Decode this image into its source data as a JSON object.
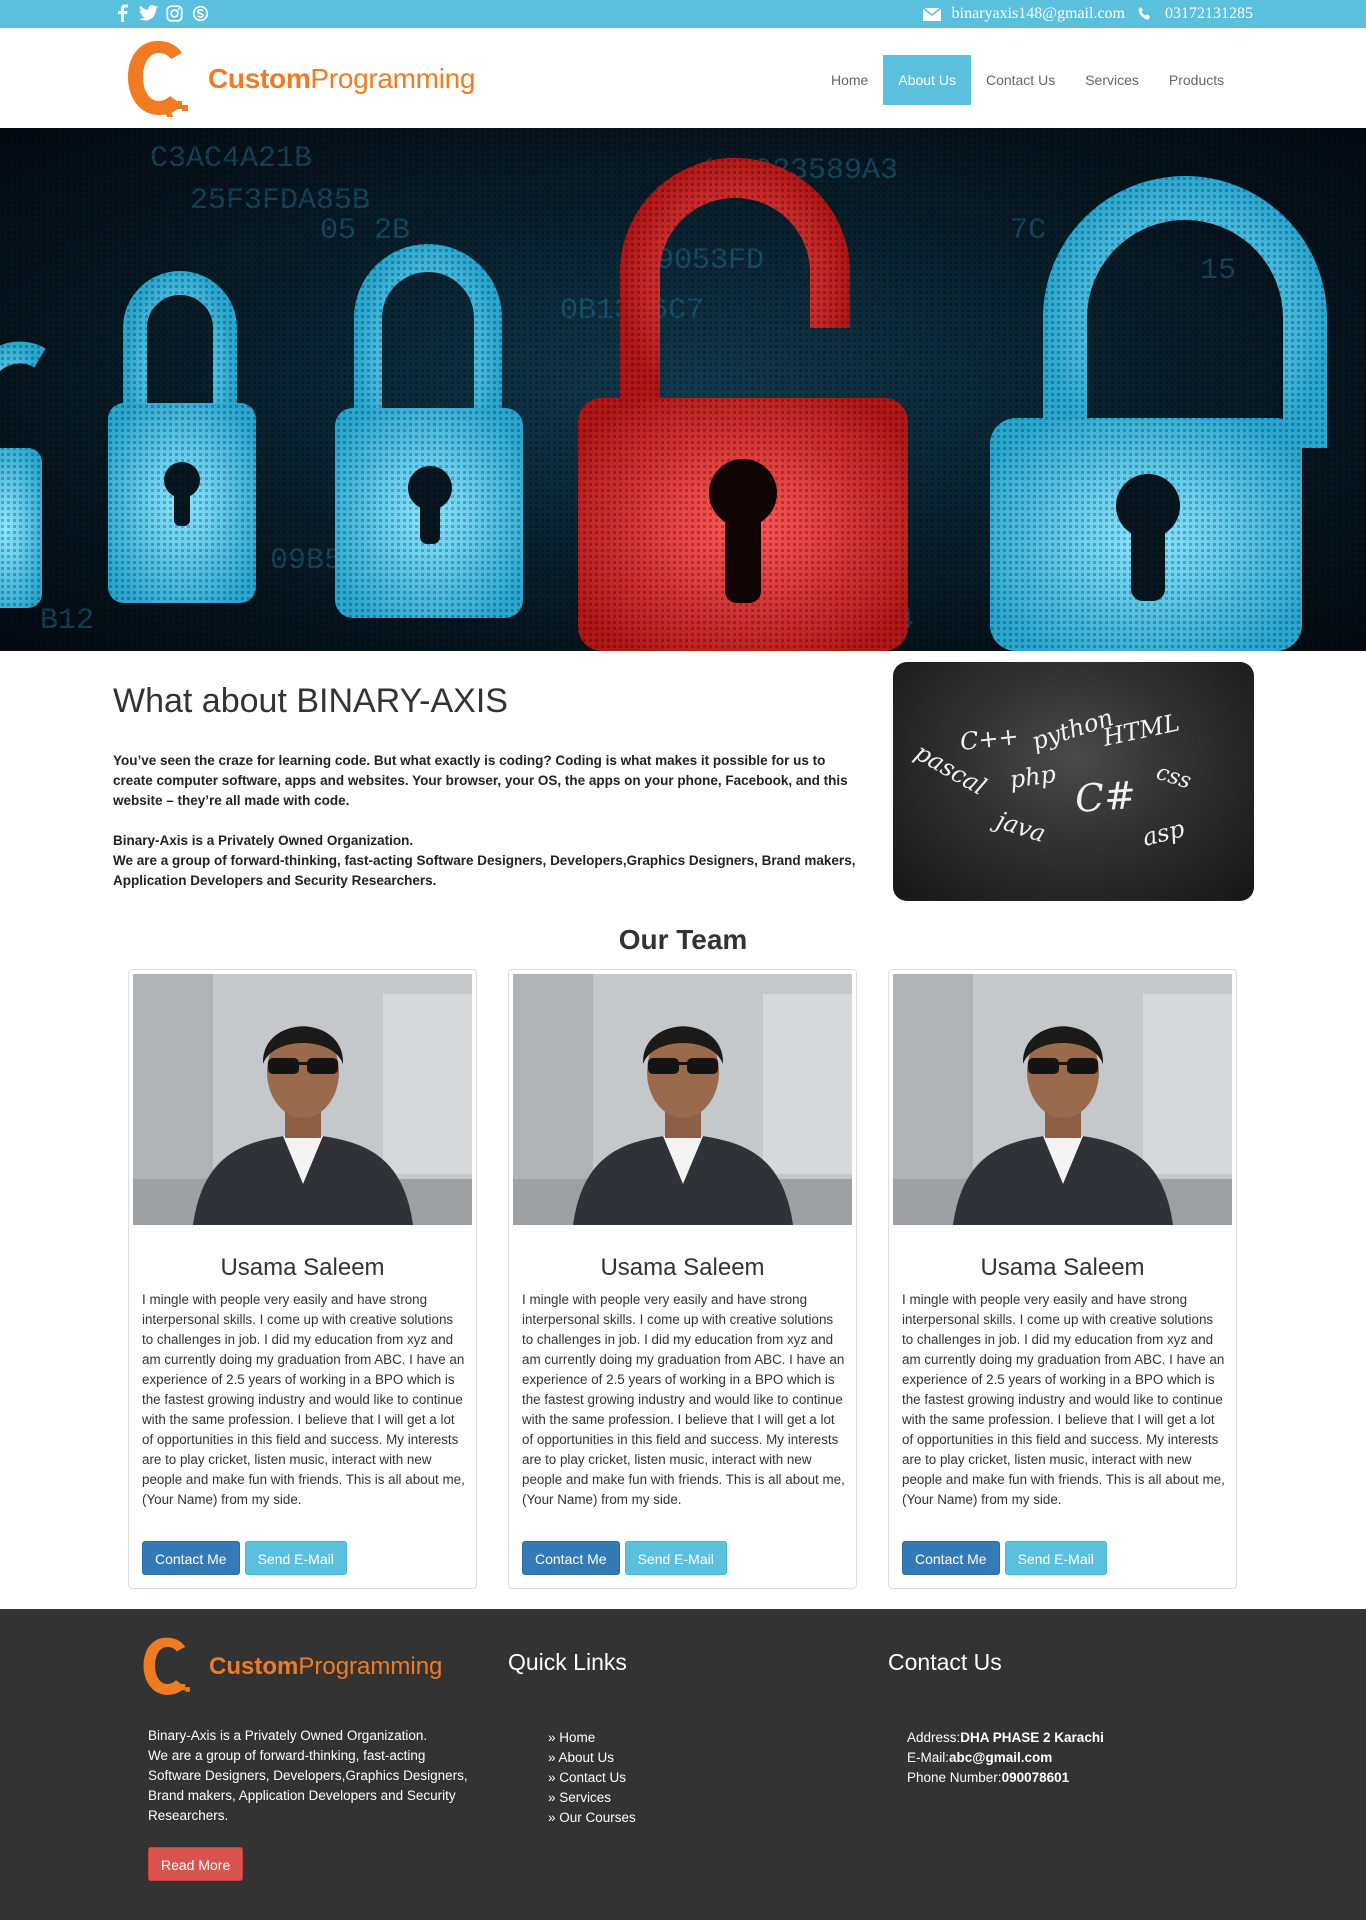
{
  "colors": {
    "accent": "#5bc0de",
    "brand_orange": "#f07b22",
    "footer_bg": "#333333",
    "primary_button": "#337ab7",
    "info_button": "#5bc0de",
    "danger_button": "#d9534f"
  },
  "topbar": {
    "social_icons": [
      "facebook-icon",
      "twitter-icon",
      "instagram-icon",
      "skype-icon"
    ],
    "email": "binaryaxis148@gmail.com",
    "phone": "03172131285"
  },
  "header": {
    "logo": {
      "word_bold": "Custom",
      "word_light": "Programming"
    },
    "nav": [
      {
        "label": "Home",
        "active": false
      },
      {
        "label": "About Us",
        "active": true
      },
      {
        "label": "Contact Us",
        "active": false
      },
      {
        "label": "Services",
        "active": false
      },
      {
        "label": "Products",
        "active": false
      }
    ]
  },
  "about": {
    "title": "What about BINARY-AXIS",
    "paragraph1": "You’ve seen the craze for learning code. But what exactly is coding? Coding is what makes it possible for us to create computer software, apps and websites. Your browser, your OS, the apps on your phone, Facebook, and this website – they’re all made with code.",
    "paragraph2_line1": "Binary-Axis is a Privately Owned Organization.",
    "paragraph2_line2": "We are a group of forward-thinking, fast-acting Software Designers, Developers,Graphics Designers, Brand makers, Application Developers and Security Researchers.",
    "chalkboard_words": [
      "C++",
      "python",
      "HTML",
      "pascal",
      "php",
      "css",
      "C#",
      "java",
      "asp"
    ]
  },
  "team": {
    "title": "Our Team",
    "members": [
      {
        "name": "Usama Saleem",
        "bio": "I mingle with people very easily and have strong interpersonal skills. I come up with creative solutions to challenges in job. I did my education from xyz and am currently doing my graduation from ABC. I have an experience of 2.5 years of working in a BPO which is the fastest growing industry and would like to continue with the same profession. I believe that I will get a lot of opportunities in this field and success. My interests are to play cricket, listen music, interact with new people and make fun with friends. This is all about me, (Your Name) from my side.",
        "contact_label": "Contact Me",
        "email_label": "Send E-Mail"
      },
      {
        "name": "Usama Saleem",
        "bio": "I mingle with people very easily and have strong interpersonal skills. I come up with creative solutions to challenges in job. I did my education from xyz and am currently doing my graduation from ABC. I have an experience of 2.5 years of working in a BPO which is the fastest growing industry and would like to continue with the same profession. I believe that I will get a lot of opportunities in this field and success. My interests are to play cricket, listen music, interact with new people and make fun with friends. This is all about me, (Your Name) from my side.",
        "contact_label": "Contact Me",
        "email_label": "Send E-Mail"
      },
      {
        "name": "Usama Saleem",
        "bio": "I mingle with people very easily and have strong interpersonal skills. I come up with creative solutions to challenges in job. I did my education from xyz and am currently doing my graduation from ABC. I have an experience of 2.5 years of working in a BPO which is the fastest growing industry and would like to continue with the same profession. I believe that I will get a lot of opportunities in this field and success. My interests are to play cricket, listen music, interact with new people and make fun with friends. This is all about me, (Your Name) from my side.",
        "contact_label": "Contact Me",
        "email_label": "Send E-Mail"
      }
    ]
  },
  "footer": {
    "logo": {
      "word_bold": "Custom",
      "word_light": "Programming"
    },
    "about_line1": "Binary-Axis is a Privately Owned Organization.",
    "about_line2": "We are a group of forward-thinking, fast-acting Software Designers, Developers,Graphics Designers, Brand makers, Application Developers and Security Researchers.",
    "read_more": "Read More",
    "quick_links_title": "Quick Links",
    "quick_links": [
      "» Home",
      "» About Us",
      "» Contact Us",
      "» Services",
      "» Our Courses"
    ],
    "contact_title": "Contact Us",
    "address_label": "Address:",
    "address_value": "DHA PHASE 2 Karachi",
    "email_label": "E-Mail:",
    "email_value": "abc@gmail.com",
    "phone_label": "Phone Number:",
    "phone_value": "090078601"
  }
}
